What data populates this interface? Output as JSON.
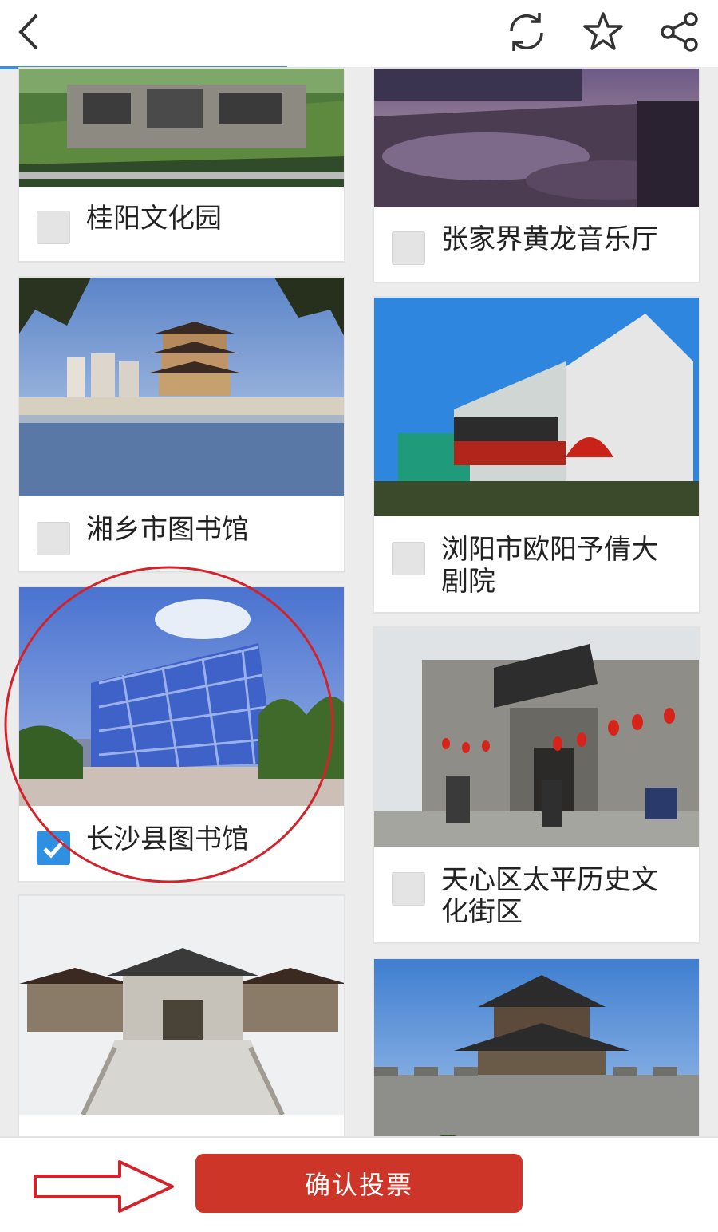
{
  "header": {
    "back_icon": "chevron-left-icon",
    "refresh_icon": "refresh-icon",
    "favorite_icon": "star-icon",
    "share_icon": "share-icon",
    "load_progress": 0.4
  },
  "venues": [
    {
      "name": "桂阳文化园",
      "checked": false
    },
    {
      "name": "张家界黄龙音乐厅",
      "checked": false
    },
    {
      "name": "湘乡市图书馆",
      "checked": false
    },
    {
      "name": "浏阳市欧阳予倩大剧院",
      "checked": false
    },
    {
      "name": "长沙县图书馆",
      "checked": true
    },
    {
      "name": "天心区太平历史文化街区",
      "checked": false
    }
  ],
  "footer": {
    "confirm_label": "确认投票",
    "arrow_icon": "right-arrow-outline-icon"
  },
  "colors": {
    "accent": "#cc3527",
    "checkbox_checked": "#2f8fe0",
    "annotation": "#d3222a"
  }
}
